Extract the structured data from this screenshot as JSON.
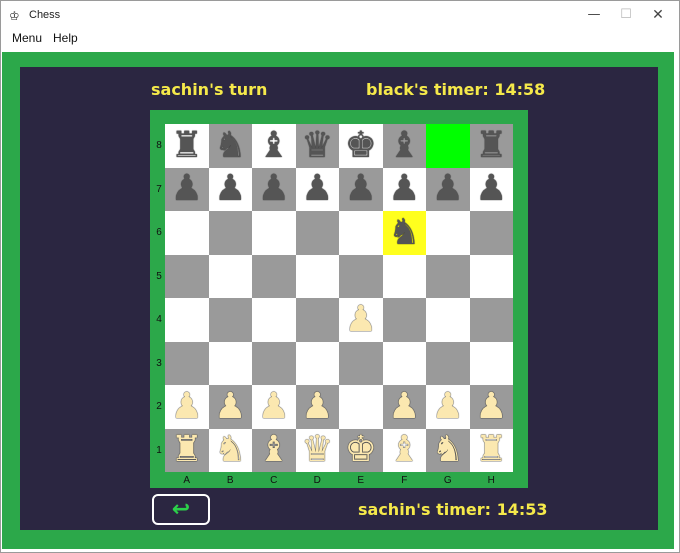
{
  "window": {
    "title": "Chess",
    "app_icon": "♔",
    "minimize": "—",
    "maximize": "☐",
    "close": "✕"
  },
  "menu": {
    "items": [
      "Menu",
      "Help"
    ]
  },
  "status": {
    "turn": "sachin's turn",
    "black_timer": "black's timer: 14:58",
    "white_timer": "sachin's timer: 14:53"
  },
  "colors": {
    "frame": "#2ca84a",
    "panel": "#2b2641",
    "text": "#f5e94a",
    "light_square": "#ffffff",
    "dark_square": "#9a9a9a",
    "selected_square": "#ffff1e",
    "last_move_square": "#00ff00"
  },
  "board": {
    "files": [
      "A",
      "B",
      "C",
      "D",
      "E",
      "F",
      "G",
      "H"
    ],
    "ranks": [
      "8",
      "7",
      "6",
      "5",
      "4",
      "3",
      "2",
      "1"
    ],
    "rows": [
      [
        "br",
        "bn",
        "bb",
        "bq",
        "bk",
        "bb",
        "",
        "br"
      ],
      [
        "bp",
        "bp",
        "bp",
        "bp",
        "bp",
        "bp",
        "bp",
        "bp"
      ],
      [
        "",
        "",
        "",
        "",
        "",
        "bn",
        "",
        ""
      ],
      [
        "",
        "",
        "",
        "",
        "",
        "",
        "",
        ""
      ],
      [
        "",
        "",
        "",
        "",
        "wp",
        "",
        "",
        ""
      ],
      [
        "",
        "",
        "",
        "",
        "",
        "",
        "",
        ""
      ],
      [
        "wp",
        "wp",
        "wp",
        "wp",
        "",
        "wp",
        "wp",
        "wp"
      ],
      [
        "wr",
        "wn",
        "wb",
        "wq",
        "wk",
        "wb",
        "wn",
        "wr"
      ]
    ],
    "selected_square": "F6",
    "last_move_from": "G8"
  },
  "undo_icon": "↩"
}
